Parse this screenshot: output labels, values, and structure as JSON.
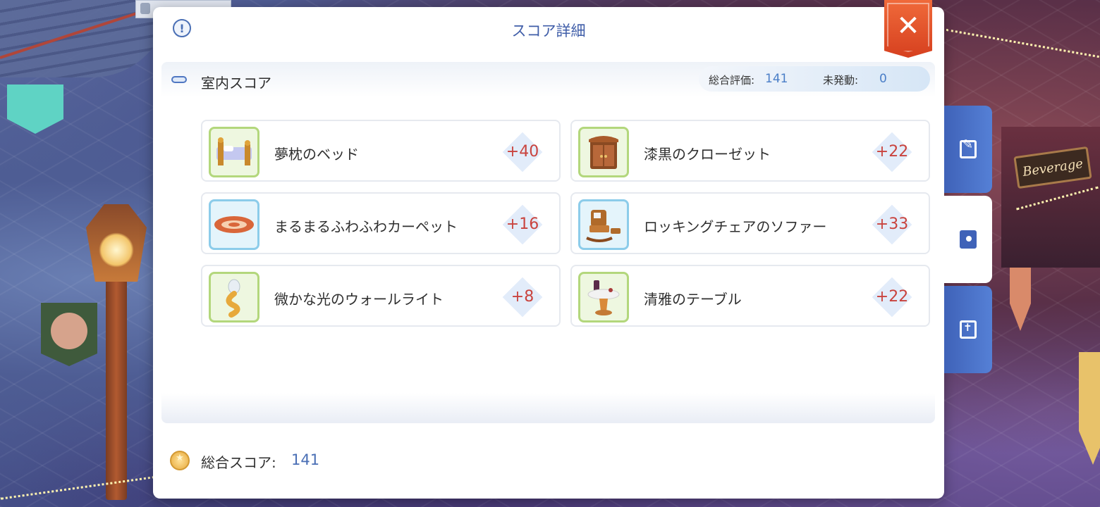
{
  "window": {
    "title": "スコア詳細"
  },
  "section": {
    "title": "室内スコア",
    "summary": {
      "overall_label": "総合評価:",
      "overall_value": "141",
      "inactive_label": "未発動:",
      "inactive_value": "0"
    }
  },
  "items": [
    {
      "name": "夢枕のベッド",
      "score": "+40",
      "icon": "bed-icon",
      "frame": "green"
    },
    {
      "name": "漆黒のクローゼット",
      "score": "+22",
      "icon": "closet-icon",
      "frame": "green"
    },
    {
      "name": "まるまるふわふわカーペット",
      "score": "+16",
      "icon": "carpet-icon",
      "frame": "blue"
    },
    {
      "name": "ロッキングチェアのソファー",
      "score": "+33",
      "icon": "rocking-chair-icon",
      "frame": "blue"
    },
    {
      "name": "微かな光のウォールライト",
      "score": "+8",
      "icon": "wall-light-icon",
      "frame": "green"
    },
    {
      "name": "清雅のテーブル",
      "score": "+22",
      "icon": "table-icon",
      "frame": "green"
    }
  ],
  "total": {
    "label": "総合スコア:",
    "value": "141"
  },
  "background": {
    "shop_sign": "Beverage"
  },
  "side_tabs": [
    {
      "icon": "edit-icon",
      "active": false
    },
    {
      "icon": "contact-book-icon",
      "active": true
    },
    {
      "icon": "scripture-icon",
      "active": false
    }
  ],
  "colors": {
    "accent_blue": "#3f62b8",
    "score_red": "#c9433e",
    "close_orange": "#e2522a"
  }
}
